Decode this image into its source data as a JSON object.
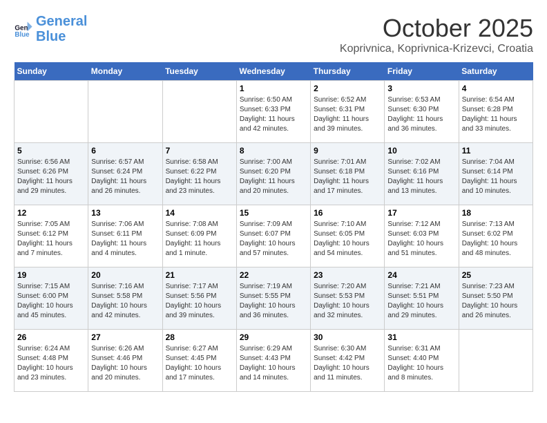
{
  "header": {
    "logo_line1": "General",
    "logo_line2": "Blue",
    "title": "October 2025",
    "subtitle": "Koprivnica, Koprivnica-Krizevci, Croatia"
  },
  "weekdays": [
    "Sunday",
    "Monday",
    "Tuesday",
    "Wednesday",
    "Thursday",
    "Friday",
    "Saturday"
  ],
  "weeks": [
    [
      {
        "day": "",
        "sunrise": "",
        "sunset": "",
        "daylight": ""
      },
      {
        "day": "",
        "sunrise": "",
        "sunset": "",
        "daylight": ""
      },
      {
        "day": "",
        "sunrise": "",
        "sunset": "",
        "daylight": ""
      },
      {
        "day": "1",
        "sunrise": "Sunrise: 6:50 AM",
        "sunset": "Sunset: 6:33 PM",
        "daylight": "Daylight: 11 hours and 42 minutes."
      },
      {
        "day": "2",
        "sunrise": "Sunrise: 6:52 AM",
        "sunset": "Sunset: 6:31 PM",
        "daylight": "Daylight: 11 hours and 39 minutes."
      },
      {
        "day": "3",
        "sunrise": "Sunrise: 6:53 AM",
        "sunset": "Sunset: 6:30 PM",
        "daylight": "Daylight: 11 hours and 36 minutes."
      },
      {
        "day": "4",
        "sunrise": "Sunrise: 6:54 AM",
        "sunset": "Sunset: 6:28 PM",
        "daylight": "Daylight: 11 hours and 33 minutes."
      }
    ],
    [
      {
        "day": "5",
        "sunrise": "Sunrise: 6:56 AM",
        "sunset": "Sunset: 6:26 PM",
        "daylight": "Daylight: 11 hours and 29 minutes."
      },
      {
        "day": "6",
        "sunrise": "Sunrise: 6:57 AM",
        "sunset": "Sunset: 6:24 PM",
        "daylight": "Daylight: 11 hours and 26 minutes."
      },
      {
        "day": "7",
        "sunrise": "Sunrise: 6:58 AM",
        "sunset": "Sunset: 6:22 PM",
        "daylight": "Daylight: 11 hours and 23 minutes."
      },
      {
        "day": "8",
        "sunrise": "Sunrise: 7:00 AM",
        "sunset": "Sunset: 6:20 PM",
        "daylight": "Daylight: 11 hours and 20 minutes."
      },
      {
        "day": "9",
        "sunrise": "Sunrise: 7:01 AM",
        "sunset": "Sunset: 6:18 PM",
        "daylight": "Daylight: 11 hours and 17 minutes."
      },
      {
        "day": "10",
        "sunrise": "Sunrise: 7:02 AM",
        "sunset": "Sunset: 6:16 PM",
        "daylight": "Daylight: 11 hours and 13 minutes."
      },
      {
        "day": "11",
        "sunrise": "Sunrise: 7:04 AM",
        "sunset": "Sunset: 6:14 PM",
        "daylight": "Daylight: 11 hours and 10 minutes."
      }
    ],
    [
      {
        "day": "12",
        "sunrise": "Sunrise: 7:05 AM",
        "sunset": "Sunset: 6:12 PM",
        "daylight": "Daylight: 11 hours and 7 minutes."
      },
      {
        "day": "13",
        "sunrise": "Sunrise: 7:06 AM",
        "sunset": "Sunset: 6:11 PM",
        "daylight": "Daylight: 11 hours and 4 minutes."
      },
      {
        "day": "14",
        "sunrise": "Sunrise: 7:08 AM",
        "sunset": "Sunset: 6:09 PM",
        "daylight": "Daylight: 11 hours and 1 minute."
      },
      {
        "day": "15",
        "sunrise": "Sunrise: 7:09 AM",
        "sunset": "Sunset: 6:07 PM",
        "daylight": "Daylight: 10 hours and 57 minutes."
      },
      {
        "day": "16",
        "sunrise": "Sunrise: 7:10 AM",
        "sunset": "Sunset: 6:05 PM",
        "daylight": "Daylight: 10 hours and 54 minutes."
      },
      {
        "day": "17",
        "sunrise": "Sunrise: 7:12 AM",
        "sunset": "Sunset: 6:03 PM",
        "daylight": "Daylight: 10 hours and 51 minutes."
      },
      {
        "day": "18",
        "sunrise": "Sunrise: 7:13 AM",
        "sunset": "Sunset: 6:02 PM",
        "daylight": "Daylight: 10 hours and 48 minutes."
      }
    ],
    [
      {
        "day": "19",
        "sunrise": "Sunrise: 7:15 AM",
        "sunset": "Sunset: 6:00 PM",
        "daylight": "Daylight: 10 hours and 45 minutes."
      },
      {
        "day": "20",
        "sunrise": "Sunrise: 7:16 AM",
        "sunset": "Sunset: 5:58 PM",
        "daylight": "Daylight: 10 hours and 42 minutes."
      },
      {
        "day": "21",
        "sunrise": "Sunrise: 7:17 AM",
        "sunset": "Sunset: 5:56 PM",
        "daylight": "Daylight: 10 hours and 39 minutes."
      },
      {
        "day": "22",
        "sunrise": "Sunrise: 7:19 AM",
        "sunset": "Sunset: 5:55 PM",
        "daylight": "Daylight: 10 hours and 36 minutes."
      },
      {
        "day": "23",
        "sunrise": "Sunrise: 7:20 AM",
        "sunset": "Sunset: 5:53 PM",
        "daylight": "Daylight: 10 hours and 32 minutes."
      },
      {
        "day": "24",
        "sunrise": "Sunrise: 7:21 AM",
        "sunset": "Sunset: 5:51 PM",
        "daylight": "Daylight: 10 hours and 29 minutes."
      },
      {
        "day": "25",
        "sunrise": "Sunrise: 7:23 AM",
        "sunset": "Sunset: 5:50 PM",
        "daylight": "Daylight: 10 hours and 26 minutes."
      }
    ],
    [
      {
        "day": "26",
        "sunrise": "Sunrise: 6:24 AM",
        "sunset": "Sunset: 4:48 PM",
        "daylight": "Daylight: 10 hours and 23 minutes."
      },
      {
        "day": "27",
        "sunrise": "Sunrise: 6:26 AM",
        "sunset": "Sunset: 4:46 PM",
        "daylight": "Daylight: 10 hours and 20 minutes."
      },
      {
        "day": "28",
        "sunrise": "Sunrise: 6:27 AM",
        "sunset": "Sunset: 4:45 PM",
        "daylight": "Daylight: 10 hours and 17 minutes."
      },
      {
        "day": "29",
        "sunrise": "Sunrise: 6:29 AM",
        "sunset": "Sunset: 4:43 PM",
        "daylight": "Daylight: 10 hours and 14 minutes."
      },
      {
        "day": "30",
        "sunrise": "Sunrise: 6:30 AM",
        "sunset": "Sunset: 4:42 PM",
        "daylight": "Daylight: 10 hours and 11 minutes."
      },
      {
        "day": "31",
        "sunrise": "Sunrise: 6:31 AM",
        "sunset": "Sunset: 4:40 PM",
        "daylight": "Daylight: 10 hours and 8 minutes."
      },
      {
        "day": "",
        "sunrise": "",
        "sunset": "",
        "daylight": ""
      }
    ]
  ]
}
